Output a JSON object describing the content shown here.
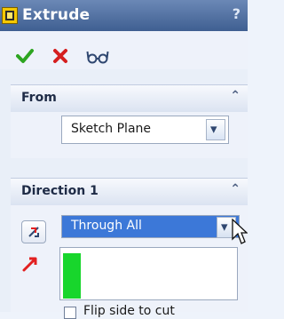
{
  "header": {
    "title": "Extrude",
    "help": "?"
  },
  "actions": {
    "ok_icon": "checkmark-icon",
    "cancel_icon": "x-icon",
    "preview_icon": "glasses-icon"
  },
  "sections": {
    "from": {
      "label": "From",
      "selected_value": "Sketch Plane"
    },
    "direction1": {
      "label": "Direction 1",
      "selected_value": "Through All",
      "flip_side_label": "Flip side to cut"
    }
  },
  "colors": {
    "title_bar": "#4f6fa1",
    "selection": "#3c78d8",
    "green_depth": "#18d62c",
    "accent_red": "#e22020"
  }
}
